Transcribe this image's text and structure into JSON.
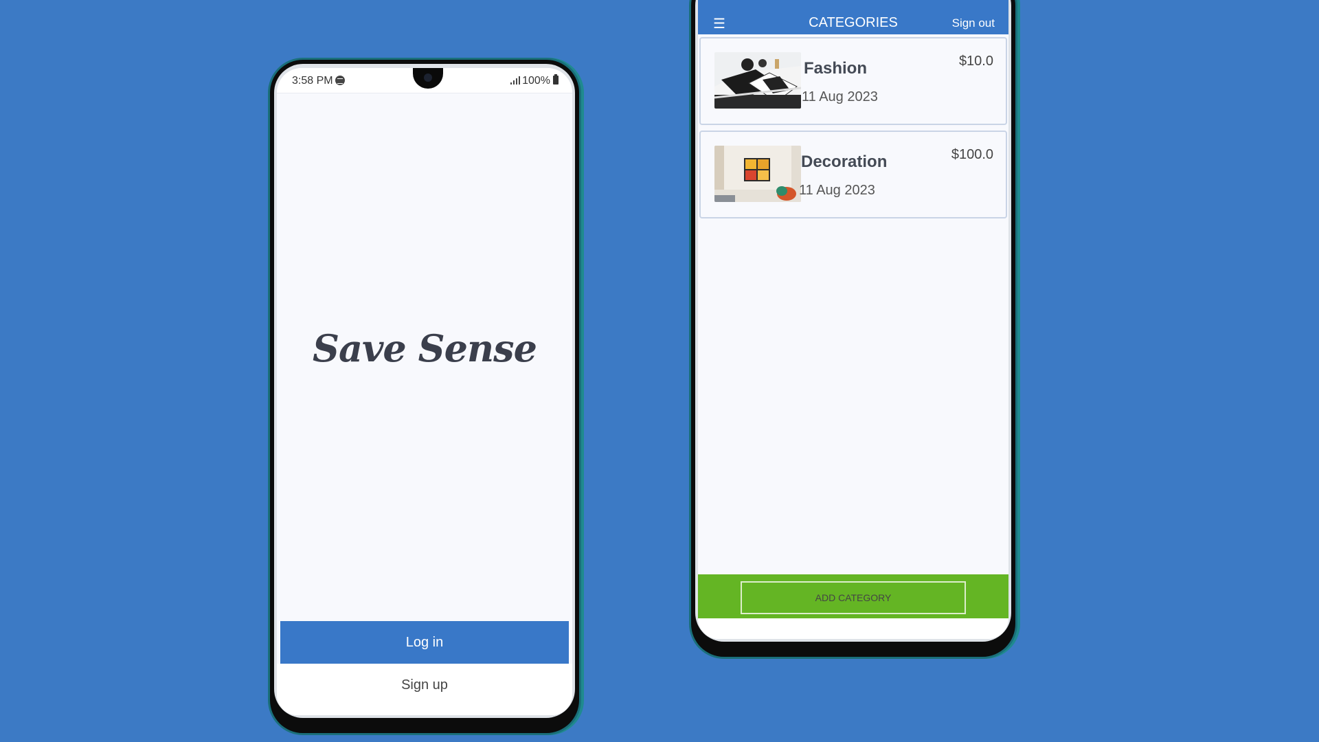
{
  "colors": {
    "background": "#3c7ac5",
    "primary": "#3978c8",
    "accent_green": "#64b524",
    "screen": "#f8f9fd"
  },
  "login_screen": {
    "status_bar": {
      "time": "3:58 PM",
      "battery": "100%",
      "icons": [
        "notification-icon",
        "signal-icon",
        "battery-icon"
      ]
    },
    "brand_name": "Save Sense",
    "login_label": "Log in",
    "signup_label": "Sign up"
  },
  "categories_screen": {
    "menu_icon": "☰",
    "title": "CATEGORIES",
    "signout_label": "Sign out",
    "categories": [
      {
        "name": "Fashion",
        "date": "11 Aug 2023",
        "price": "$10.0",
        "thumb": "fashion-image"
      },
      {
        "name": "Decoration",
        "date": "11 Aug 2023",
        "price": "$100.0",
        "thumb": "decoration-image"
      }
    ],
    "add_label": "ADD CATEGORY"
  }
}
